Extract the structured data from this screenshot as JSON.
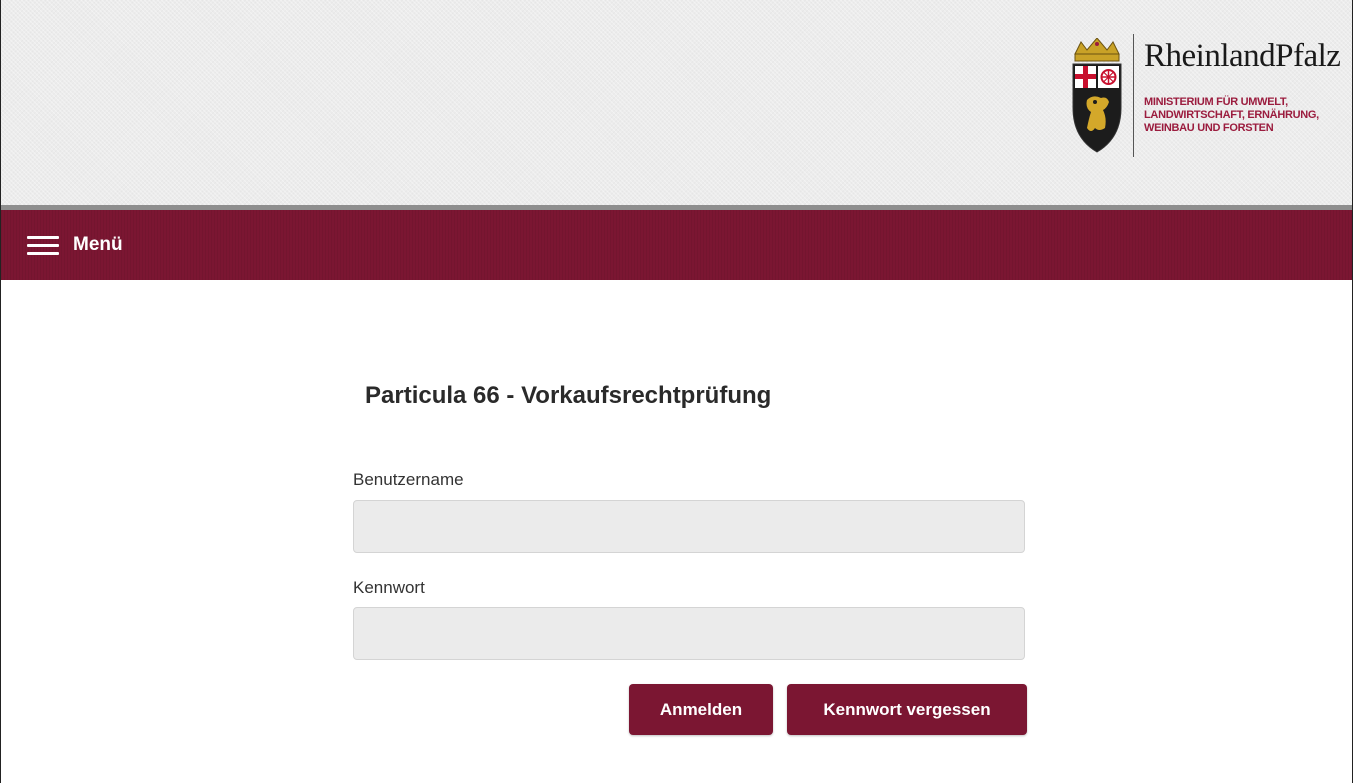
{
  "header": {
    "brand_name": "RheinlandPfalz",
    "ministry_lines": [
      "MINISTERIUM FÜR UMWELT,",
      "LANDWIRTSCHAFT, ERNÄHRUNG,",
      "WEINBAU UND FORSTEN"
    ],
    "coat_of_arms_icon": "coat-of-arms-icon"
  },
  "nav": {
    "menu_label": "Menü",
    "menu_icon": "hamburger-icon"
  },
  "login": {
    "title": "Particula 66 - Vorkaufsrechtprüfung",
    "username_label": "Benutzername",
    "username_value": "",
    "password_label": "Kennwort",
    "password_value": "",
    "login_button": "Anmelden",
    "forgot_button": "Kennwort vergessen"
  },
  "colors": {
    "brand_red": "#7b1632",
    "ministry_text": "#9b1c3e",
    "header_bg": "#ececec",
    "input_bg": "#ebebeb"
  }
}
